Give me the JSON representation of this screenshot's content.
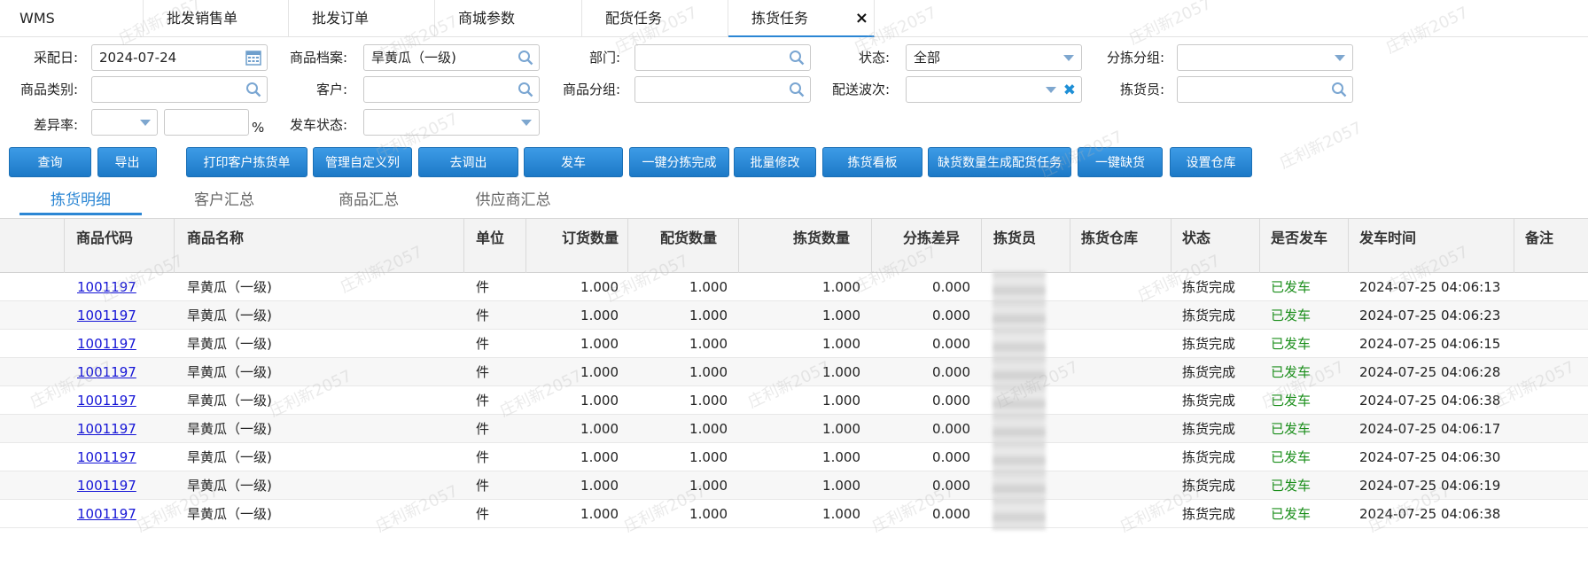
{
  "tabs": [
    {
      "label": "WMS"
    },
    {
      "label": "批发销售单"
    },
    {
      "label": "批发订单"
    },
    {
      "label": "商城参数"
    },
    {
      "label": "配货任务"
    },
    {
      "label": "拣货任务",
      "close": "×"
    }
  ],
  "filters": {
    "pick_date_label": "采配日:",
    "pick_date_value": "2024-07-24",
    "product_file_label": "商品档案:",
    "product_file_value": "旱黄瓜（一级)",
    "dept_label": "部门:",
    "status_label": "状态:",
    "status_value": "全部",
    "sort_group_label": "分拣分组:",
    "category_label": "商品类别:",
    "customer_label": "客户:",
    "product_group_label": "商品分组:",
    "delivery_batch_label": "配送波次:",
    "picker_label": "拣货员:",
    "diff_rate_label": "差异率:",
    "percent": "%",
    "ship_status_label": "发车状态:"
  },
  "buttons": [
    {
      "label": "查询"
    },
    {
      "label": "导出"
    },
    {
      "label": "打印客户拣货单"
    },
    {
      "label": "管理自定义列"
    },
    {
      "label": "去调出"
    },
    {
      "label": "发车"
    },
    {
      "label": "一键分拣完成"
    },
    {
      "label": "批量修改"
    },
    {
      "label": "拣货看板"
    },
    {
      "label": "缺货数量生成配货任务"
    },
    {
      "label": "一键缺货"
    },
    {
      "label": "设置仓库"
    }
  ],
  "subtabs": [
    {
      "label": "拣货明细"
    },
    {
      "label": "客户汇总"
    },
    {
      "label": "商品汇总"
    },
    {
      "label": "供应商汇总"
    }
  ],
  "table": {
    "columns": [
      "商品代码",
      "商品名称",
      "单位",
      "订货数量",
      "配货数量",
      "拣货数量",
      "分拣差异",
      "拣货员",
      "拣货仓库",
      "状态",
      "是否发车",
      "发车时间",
      "备注"
    ],
    "rows": [
      [
        "1001197",
        "旱黄瓜（一级)",
        "件",
        "1.000",
        "1.000",
        "1.000",
        "0.000",
        "",
        "",
        "拣货完成",
        "已发车",
        "2024-07-25 04:06:13",
        ""
      ],
      [
        "1001197",
        "旱黄瓜（一级)",
        "件",
        "1.000",
        "1.000",
        "1.000",
        "0.000",
        "",
        "",
        "拣货完成",
        "已发车",
        "2024-07-25 04:06:23",
        ""
      ],
      [
        "1001197",
        "旱黄瓜（一级)",
        "件",
        "1.000",
        "1.000",
        "1.000",
        "0.000",
        "",
        "",
        "拣货完成",
        "已发车",
        "2024-07-25 04:06:15",
        ""
      ],
      [
        "1001197",
        "旱黄瓜（一级)",
        "件",
        "1.000",
        "1.000",
        "1.000",
        "0.000",
        "",
        "",
        "拣货完成",
        "已发车",
        "2024-07-25 04:06:28",
        ""
      ],
      [
        "1001197",
        "旱黄瓜（一级)",
        "件",
        "1.000",
        "1.000",
        "1.000",
        "0.000",
        "",
        "",
        "拣货完成",
        "已发车",
        "2024-07-25 04:06:38",
        ""
      ],
      [
        "1001197",
        "旱黄瓜（一级)",
        "件",
        "1.000",
        "1.000",
        "1.000",
        "0.000",
        "",
        "",
        "拣货完成",
        "已发车",
        "2024-07-25 04:06:17",
        ""
      ],
      [
        "1001197",
        "旱黄瓜（一级)",
        "件",
        "1.000",
        "1.000",
        "1.000",
        "0.000",
        "",
        "",
        "拣货完成",
        "已发车",
        "2024-07-25 04:06:30",
        ""
      ],
      [
        "1001197",
        "旱黄瓜（一级)",
        "件",
        "1.000",
        "1.000",
        "1.000",
        "0.000",
        "",
        "",
        "拣货完成",
        "已发车",
        "2024-07-25 04:06:19",
        ""
      ],
      [
        "1001197",
        "旱黄瓜（一级)",
        "件",
        "1.000",
        "1.000",
        "1.000",
        "0.000",
        "",
        "",
        "拣货完成",
        "已发车",
        "2024-07-25 04:06:38",
        ""
      ]
    ]
  },
  "watermark": "庄利新2057",
  "colors": {
    "accent": "#2b86d4",
    "button": "#1c79c7",
    "link": "#1515d6",
    "shipped": "#1b8e1b"
  }
}
